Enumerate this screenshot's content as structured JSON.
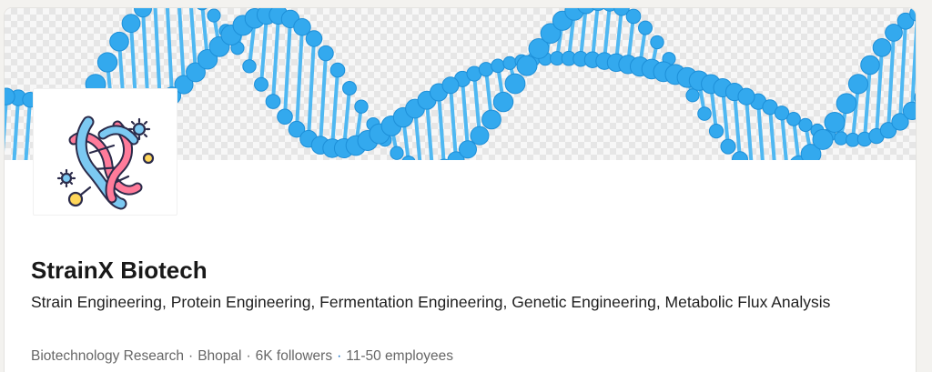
{
  "company": {
    "name": "StrainX Biotech",
    "tagline": "Strain Engineering, Protein Engineering, Fermentation Engineering, Genetic Engineering, Metabolic Flux Analysis",
    "industry": "Biotechnology Research",
    "location": "Bhopal",
    "followers": "6K followers",
    "employees": "11-50 employees"
  },
  "colors": {
    "dna_blue": "#33a9ee",
    "logo_blue": "#7cc9f2",
    "logo_pink": "#ff7b9a",
    "logo_yellow": "#ffd65a",
    "link_blue": "#0a66c2"
  },
  "icons": {
    "banner": "dna-helix-icon",
    "logo": "dna-molecule-icon"
  }
}
